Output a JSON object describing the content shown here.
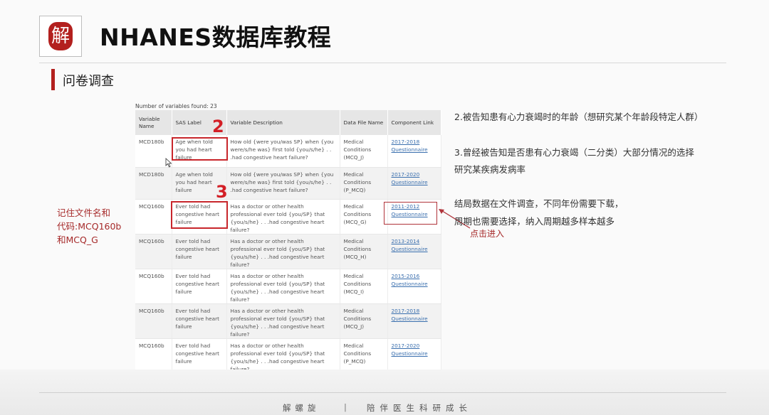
{
  "header": {
    "logo_char": "解",
    "title": "NHANES数据库教程"
  },
  "section": {
    "title": "问卷调查"
  },
  "table": {
    "count_text": "Number of variables found: 23",
    "columns": [
      "Variable Name",
      "SAS Label",
      "Variable Description",
      "Data File Name",
      "Component Link"
    ],
    "rows": [
      {
        "name": "MCD180b",
        "label": "Age when told you had heart failure",
        "description": "How old {were you/was SP} when {you were/s/he was} first told {you/s/he} . . .had congestive heart failure?",
        "file": "Medical Conditions (MCQ_J)",
        "link1": "2017-2018",
        "link2": "Questionnaire"
      },
      {
        "name": "MCD180b",
        "label": "Age when told you had heart failure",
        "description": "How old {were you/was SP} when {you were/s/he was} first told {you/s/he} . . .had congestive heart failure?",
        "file": "Medical Conditions (P_MCQ)",
        "link1": "2017-2020",
        "link2": "Questionnaire"
      },
      {
        "name": "MCQ160b",
        "label": "Ever told had congestive heart failure",
        "description": "Has a doctor or other health professional ever told {you/SP} that {you/s/he} . . .had congestive heart failure?",
        "file": "Medical Conditions (MCQ_G)",
        "link1": "2011-2012",
        "link2": "Questionnaire"
      },
      {
        "name": "MCQ160b",
        "label": "Ever told had congestive heart failure",
        "description": "Has a doctor or other health professional ever told {you/SP} that {you/s/he} . . .had congestive heart failure?",
        "file": "Medical Conditions (MCQ_H)",
        "link1": "2013-2014",
        "link2": "Questionnaire"
      },
      {
        "name": "MCQ160b",
        "label": "Ever told had congestive heart failure",
        "description": "Has a doctor or other health professional ever told {you/SP} that {you/s/he} . . .had congestive heart failure?",
        "file": "Medical Conditions (MCQ_I)",
        "link1": "2015-2016",
        "link2": "Questionnaire"
      },
      {
        "name": "MCQ160b",
        "label": "Ever told had congestive heart failure",
        "description": "Has a doctor or other health professional ever told {you/SP} that {you/s/he} . . .had congestive heart failure?",
        "file": "Medical Conditions (MCQ_J)",
        "link1": "2017-2018",
        "link2": "Questionnaire"
      },
      {
        "name": "MCQ160b",
        "label": "Ever told had congestive heart failure",
        "description": "Has a doctor or other health professional ever told {you/SP} that {you/s/he} . . .had congestive heart failure?",
        "file": "Medical Conditions (P_MCQ)",
        "link1": "2017-2020",
        "link2": "Questionnaire"
      }
    ]
  },
  "annotations": {
    "num2": "2",
    "num3": "3",
    "left_note": [
      "记住文件名和",
      "代码:MCQ160b",
      "和MCQ_G"
    ],
    "right_1": "2.被告知患有心力衰竭时的年龄（想研究某个年龄段特定人群）",
    "right_2a": "3.曾经被告知是否患有心力衰竭（二分类）大部分情况的选择",
    "right_2b": "研究某疾病发病率",
    "right_3a": "结局数据在文件调查，不同年份需要下载，",
    "right_3b": "周期也需要选择，纳入周期越多样本越多",
    "click_hint": "点击进入",
    "accent_color": "#b3201e"
  },
  "footer": {
    "left": "解螺旋",
    "separator": "|",
    "right": "陪伴医生科研成长"
  }
}
